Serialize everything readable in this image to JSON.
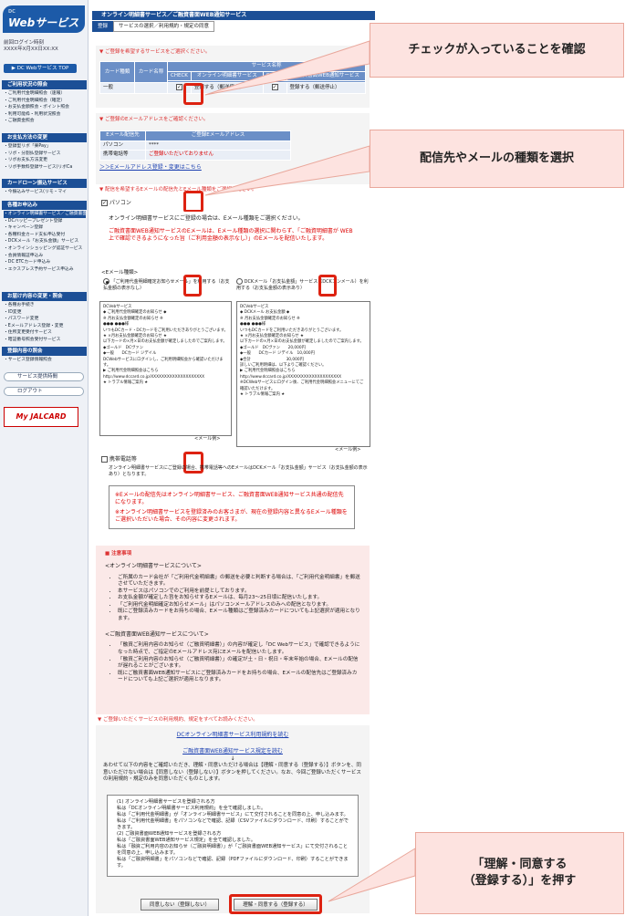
{
  "sidebar": {
    "logo": "Webサービス",
    "logo_small": "DC",
    "login_label": "前回ログイン時刻",
    "login_value": "XXXX年X月XX日XX:XX",
    "top_button": "▶ DC Webサービス TOP",
    "sections": [
      {
        "head": "ご利用状況の照会",
        "items": [
          "ご利用代金明細照会（速報）",
          "ご利用代金明細照会（確定）",
          "お支払金額照会・ポイント照会",
          "利用可能枠・利用状況照会",
          "ご融資金照会"
        ]
      },
      {
        "head": "お支払方法の変更",
        "items": [
          "登録型リボ「楽Pay」",
          "リボ・分割払登録サービス",
          "リボお支払方法変更",
          "リボ手数料登録サービス(リボCa"
        ]
      },
      {
        "head": "カードローン振込サービス",
        "items": [
          "今振込みサービス(リモ・マイ"
        ]
      },
      {
        "head": "各種お申込み",
        "items": [
          "オンライン明細書サービス／ご融資書面WEB通知サービス",
          "DCハッピープレゼント登録",
          "キャンペーン登録",
          "各種料金カード支払申込受付",
          "DCKメール「お支払金額」サービス",
          "オンラインショッピング認証サービス",
          "会員情報証申込み",
          "DC ETCカード申込み",
          "エクスプレス予約サービス申込み"
        ]
      },
      {
        "head": "お届け内容の変更・照会",
        "items": [
          "各種お手続き",
          "ID変更",
          "パスワード変更",
          "Eメールアドレス登録・変更",
          "住所変更受付サービス",
          "暗証番号照会受付サービス"
        ]
      },
      {
        "head": "登録内容の照会",
        "items": [
          "サービス登録情報照会"
        ]
      }
    ],
    "link_time": "サービス提供時間",
    "link_logout": "ログアウト",
    "jal": "My JALCARD"
  },
  "main": {
    "title": "オンライン明細書サービス／ご融資書面WEB通知サービス",
    "steps": [
      "登録",
      "サービスの選択／利用規約・規定の同意"
    ],
    "s1_head": "▼ ご登録を希望するサービスをご選択ください。",
    "s1_table": {
      "h_card": "カード種類",
      "h_name": "カード名称",
      "h_group": "サービス名称",
      "h_check": "CHECK",
      "h_online": "オンライン明細書サービス",
      "h_web": "ご融資書面WEB通知サービス",
      "row_card": "一般",
      "row_online": "登録する（郵送停止）",
      "row_web": "登録する（郵送停止）"
    },
    "s2_head": "▼ ご登録のEメールアドレスをご確認ください。",
    "s2_table": {
      "h_type": "Eメール配信先",
      "h_addr": "ご登録Eメールアドレス",
      "r1_type": "パソコン",
      "r1_addr": "****",
      "r2_type": "携帯電話等",
      "r2_addr": "ご登録いただいておりません"
    },
    "s2_link": "＞＞Eメールアドレス登録・変更はこちら",
    "s3_head": "▼ 配信を希望するEメールの配信先とEメール種類をご選択ください。",
    "pc_label": "パソコン",
    "pc_text": "オンライン明細書サービスにご登録の場合は、Eメール種類をご選択ください。",
    "pc_red": "ご融資書面WEB通知サービスのEメールは、Eメール種類の選択に関わらず、「ご融資明細書が WEB上で確認できるようになった旨（ご利用金額の表示なし）」のEメールを配信いたします。",
    "mailtype_label": "<Eメール種類>",
    "opt1": "「ご利用代金明細確定お知らせメール」を利用する（お支払金額の表示なし）",
    "opt2": "DCKメール「お支払金額」サービス（DCKコンメール）を利用する（お支払金額の表示あり）",
    "mail1": [
      "DCVebサービス",
      "◆ ご利用代金明細確定のお知らせ ◆",
      "※ 月お支払金額確定のお知らせ ※",
      "●●● ●●●様",
      "いつもDCカード・DCカードをご利用いただきありがとうございます。",
      "★ ×月お支払金額確定のお知らせ ★",
      "以下カードの×月×日のお支払金額が確定しましたのでご案内します。",
      "◆ゴールド　DCヴァン",
      "◆一般　　DCカード ジデイル",
      "DCWebサービスにログインし、ご利用明細照会から確認いただけます。",
      "▶ ご利用代金明細照会はこちら",
      "http://www.dccard.co.jp/XXXXXXXXXXXXXXXXXXXX",
      "★ トラブル情報ご案内 ★"
    ],
    "mail1_cap": "<メール例>",
    "mail2": [
      "DCVebサービス",
      "◆ DCKメール お支払金額 ◆",
      "※ 月お支払金額確定のお知らせ ※",
      "●●● ●●●様",
      "いつもDCカードをご利用いただきありがとうございます。",
      "★ ×月お支払金額確定のお知らせ ★",
      "以下カードの×月×日のお支払金額が確定しましたのでご案内します。",
      "◆ゴールド　DCヴァン　　20,000円",
      "◆一般　　DCカード ジデイル　10,000円",
      "◆合計　　　　　　　　　30,000円",
      "詳しいご利用明細は、以下よりご確認ください。",
      "▶ ご利用代金明細照会はこちら",
      "http://www.dccard.co.jp/XXXXXXXXXXXXXXXXXXXX",
      "※DCWebサービスにログイン後、ご利用代金明細照会メニューにてご確認いただけます。",
      "★ トラブル情報ご案内 ★"
    ],
    "mail2_cap": "<メール例>",
    "mobile_label": "携帯電話等",
    "mobile_text": "オンライン明細書サービスにご登録の場合、携帯電話等へのEメールはDCKメール「お支払金額」サービス（お支払金額の表示あり）となります。",
    "notice1": "※Eメールの配信先はオンライン明細書サービス、ご融資書面WEB通知サービス共通の配信先になります。",
    "notice2": "※オンライン明細書サービスを登録済みのお客さまが、現在の登録内容と異なるEメール種類をご選択いただいた場合、その内容に変更されます。",
    "caution_head": "■ 注意事項",
    "caution_online_head": "<オンライン明細書サービスについて>",
    "caution_online": [
      "ご所属のカード会社が「ご利用代金明細書」の郵送を必要と判断する場合は、「ご利用代金明細書」を郵送させていただきます。",
      "本サービスはパソコンでのご利用を前提としております。",
      "お支払金額が確定した旨をお知らせするEメールは、毎月23〜25日頃に配信いたします。",
      "「ご利用代金明細確定お知らせメール」はパソコンメールアドレスのみへの配信となります。",
      "既にご登録済みカードをお持ちの場合、Eメール種類はご登録済みカードについても上記選択が適用となります。"
    ],
    "caution_web_head": "<ご融資書面WEB通知サービスについて>",
    "caution_web": [
      "「融資ご利用内容のお知らせ（ご融資明細書）」の内容が確定し「DC Webサービス」で確認できるようになった時点で、ご指定のEメールアドレス宛にEメールを配信いたします。",
      "「融資ご利用内容のお知らせ（ご融資明細書）」の確定が土・日・祝日・年末年始の場合、Eメールの配信が遅れることがございます。",
      "既にご融資書面WEB通知サービスにご登録済みカードをお持ちの場合、Eメールの配信先はご登録済みカードについても上記ご選択が適用となります。"
    ],
    "s4_head": "▼ ご登録いただくサービスの利用規約、規定をすべてお読みください。",
    "link_terms1": "DCオンライン明細書サービス利用規約を読む",
    "link_terms2": "ご融資書面WEB通知サービス規定を読む",
    "arrow": "↓",
    "agree_text": "あわせて以下の内容をご確認いただき、理解・同意いただける場合は【理解・同意する（登録する）】ボタンを、同意いただけない場合は【同意しない（登録しない）】ボタンを押してください。なお、今回ご登録いただくサービスの利用規約・規定のみを同意いただくものとします。",
    "confirm": [
      "(1) オンライン明細書サービスを登録される方",
      "私は「DCオンライン明細書サービス利用規約」を全て確認しました。",
      "私は「ご利用代金明細書」が「オンライン明細書サービス」にて交付されることを同意の上、申し込みます。",
      "私は「ご利用代金明細書」をパソコンなどで確認、記録（CSVファイルにダウンロード、印刷）することができます。",
      "(2) ご融資書面WEB通知サービスを登録される方",
      "私は「ご融資書面WEB通知サービス規定」を全て確認しました。",
      "私は「融資ご利用内容のお知らせ（ご融資明細書）」が「ご融資書面WEB通知サービス」にて交付されることを同意の上、申し込みます。",
      "私は「ご融資明細書」をパソコンなどで確認、記録（PDFファイルにダウンロード、印刷）することができます。"
    ],
    "btn_disagree": "同意しない（登録しない）",
    "btn_agree": "理解・同意する（登録する）"
  },
  "callouts": {
    "c1": "チェックが入っていることを確認",
    "c2": "配信先やメールの種類を選択",
    "c3_l1": "「理解・同意する",
    "c3_l2": "（登録する）」を押す"
  },
  "colors": {
    "brand": "#1c4f96",
    "highlight": "#d21111",
    "callout_bg": "#fde3e0"
  }
}
